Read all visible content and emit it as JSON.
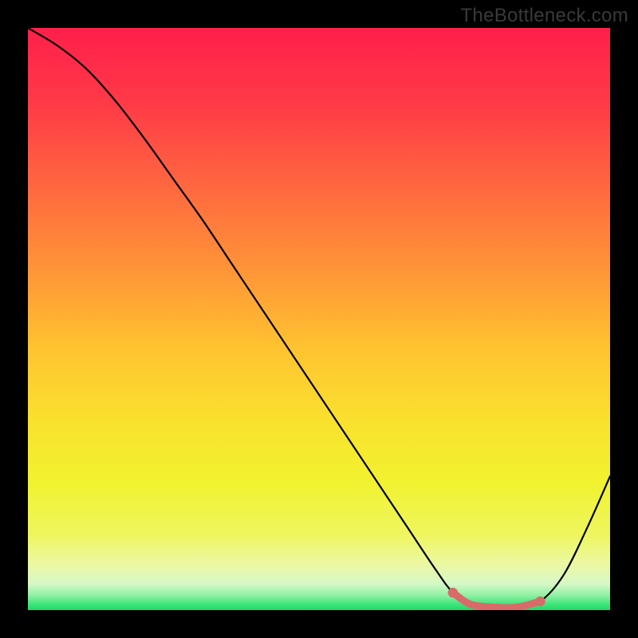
{
  "watermark": "TheBottleneck.com",
  "chart_data": {
    "type": "line",
    "title": "",
    "xlabel": "",
    "ylabel": "",
    "xlim": [
      0,
      100
    ],
    "ylim": [
      0,
      100
    ],
    "series": [
      {
        "name": "bottleneck-curve",
        "x": [
          0,
          5,
          10,
          15,
          20,
          25,
          30,
          35,
          40,
          45,
          50,
          55,
          60,
          65,
          70,
          73,
          76,
          80,
          84,
          88,
          92,
          96,
          100
        ],
        "y": [
          100,
          97,
          93,
          87.5,
          81,
          74,
          67,
          59.5,
          52,
          44.5,
          37,
          29.5,
          22,
          14.5,
          7,
          3,
          1,
          0.5,
          0.5,
          1.5,
          6,
          14,
          23
        ]
      },
      {
        "name": "optimal-segment",
        "x": [
          73,
          76,
          80,
          84,
          88
        ],
        "y": [
          3,
          1,
          0.5,
          0.5,
          1.5
        ]
      }
    ],
    "gradient_stops": [
      {
        "pos": 0.0,
        "color": "#ff1f4b"
      },
      {
        "pos": 0.13,
        "color": "#ff3a47"
      },
      {
        "pos": 0.28,
        "color": "#ff6a3f"
      },
      {
        "pos": 0.42,
        "color": "#ff9637"
      },
      {
        "pos": 0.55,
        "color": "#ffc330"
      },
      {
        "pos": 0.68,
        "color": "#f9e22e"
      },
      {
        "pos": 0.78,
        "color": "#f1f22f"
      },
      {
        "pos": 0.87,
        "color": "#eef65e"
      },
      {
        "pos": 0.92,
        "color": "#ecf8a2"
      },
      {
        "pos": 0.955,
        "color": "#d6f8c7"
      },
      {
        "pos": 0.975,
        "color": "#8ef0a2"
      },
      {
        "pos": 0.99,
        "color": "#3de57b"
      },
      {
        "pos": 1.0,
        "color": "#1fd968"
      }
    ],
    "colors": {
      "curve": "#000000",
      "optimal": "#d96a6a",
      "background_frame": "#000000"
    }
  }
}
